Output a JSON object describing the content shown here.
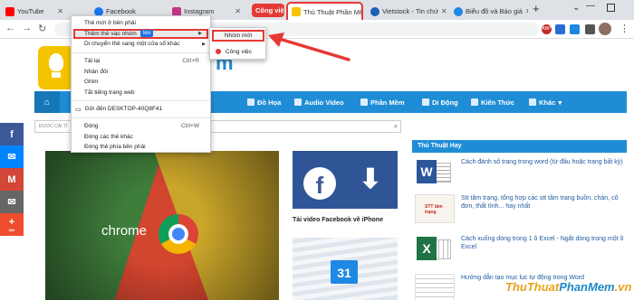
{
  "tabs": [
    {
      "label": "YouTube",
      "color": "#ff0000"
    },
    {
      "label": "Facebook",
      "color": "#1877f2"
    },
    {
      "label": "Instagram",
      "color": "#c13584"
    },
    {
      "label": "Công việc",
      "color": "#e53935"
    },
    {
      "label": "Thủ Thuật Phần Mề",
      "color": "#f5c400"
    },
    {
      "label": "Vietstock - Tin chứ",
      "color": "#1e5fb4"
    },
    {
      "label": "Biểu đồ và Báo giá",
      "color": "#1e88e5"
    }
  ],
  "toolbar": {
    "ext_badge": "ABP"
  },
  "logo_text": "m",
  "nav_items": [
    "Đồ Họa",
    "Audio Video",
    "Phần Mềm",
    "Di Động",
    "Kiến Thức",
    "Khác"
  ],
  "search_placeholder": "ĐƯỢC CÁI TÌ",
  "hero_word": "chrome",
  "fb_caption": "Tải video Facebook về iPhone",
  "calendar_day": "31",
  "sidebar_title": "Thủ Thuật Hay",
  "sidebar_items": [
    "Cách đánh số trang trong word (từ đầu hoặc trang bất kỳ)",
    "Stt tâm trạng, tổng hợp các stt tâm trạng buồn, chán, cô đơn, thất tình... hay nhất",
    "Cách xuống dòng trong 1 ô Excel - Ngắt dòng trong một ô Excel",
    "Hướng dẫn tạo mục lục tự động trong Word"
  ],
  "sidebar_thumb_text": "STT tâm trạng",
  "social_plus_count": "800",
  "context_menu": {
    "items": [
      {
        "label": "Thẻ mới ở bên phải",
        "shortcut": "",
        "kind": "item"
      },
      {
        "label": "Thêm thẻ vào nhóm",
        "badge": "Mới",
        "kind": "submenu-hl"
      },
      {
        "label": "Di chuyển thẻ sang một cửa sổ khác",
        "kind": "submenu"
      },
      {
        "kind": "sep"
      },
      {
        "label": "Tải lại",
        "shortcut": "Ctrl+R",
        "kind": "item"
      },
      {
        "label": "Nhân đôi",
        "kind": "item"
      },
      {
        "label": "Ghim",
        "kind": "item"
      },
      {
        "label": "Tắt tiếng trang web",
        "kind": "item"
      },
      {
        "kind": "sep"
      },
      {
        "label": "Gửi đến DESKTOP-40Q8F41",
        "kind": "item-icon"
      },
      {
        "kind": "sep"
      },
      {
        "label": "Đóng",
        "shortcut": "Ctrl+W",
        "kind": "item"
      },
      {
        "label": "Đóng các thẻ khác",
        "kind": "item"
      },
      {
        "label": "Đóng thẻ phía bên phải",
        "kind": "item"
      }
    ]
  },
  "submenu": {
    "new_group": "Nhóm mới",
    "work": "Công việc"
  },
  "watermark": {
    "part1": "ThuThuat",
    "part2": "PhanMem",
    "part3": ".vn"
  },
  "colors": {
    "accent": "#e53935",
    "nav": "#1f8dd6",
    "facebook": "#3b5998",
    "twitter": "#1da1f2",
    "gmail": "#d44638",
    "mail": "#666666",
    "plus": "#ee4c2c"
  }
}
